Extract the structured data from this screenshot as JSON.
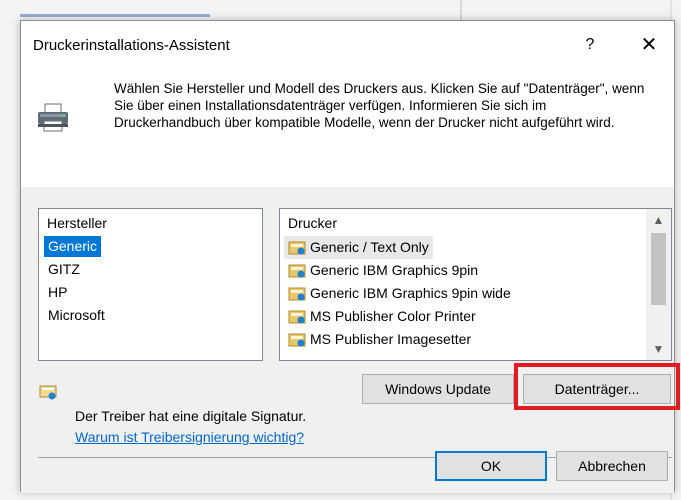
{
  "dialog": {
    "title": "Druckerinstallations-Assistent",
    "help": "?",
    "close": "✕",
    "instructions": "Wählen Sie Hersteller und Modell des Druckers aus. Klicken Sie auf \"Datenträger\", wenn Sie über einen Installationsdatenträger verfügen. Informieren Sie sich im Druckerhandbuch über kompatible Modelle, wenn der Drucker nicht aufgeführt wird."
  },
  "manufacturers": {
    "header": "Hersteller",
    "items": [
      "Generic",
      "GITZ",
      "HP",
      "Microsoft"
    ],
    "selected": "Generic"
  },
  "printers": {
    "header": "Drucker",
    "items": [
      "Generic / Text Only",
      "Generic IBM Graphics 9pin",
      "Generic IBM Graphics 9pin wide",
      "MS Publisher Color Printer",
      "MS Publisher Imagesetter"
    ],
    "selected": "Generic / Text Only"
  },
  "buttons": {
    "windows_update": "Windows Update",
    "have_disk": "Datenträger...",
    "ok": "OK",
    "cancel": "Abbrechen"
  },
  "signature": {
    "text": "Der Treiber hat eine digitale Signatur.",
    "link": "Warum ist Treibersignierung wichtig?"
  },
  "scrollbar": {
    "up": "▲",
    "down": "▼"
  },
  "colors": {
    "selection": "#0078d7",
    "link": "#0066cc",
    "highlight_box": "#e11b22"
  },
  "icons": {
    "printer": "printer-icon",
    "driver": "driver-icon",
    "certificate": "certificate-icon"
  }
}
